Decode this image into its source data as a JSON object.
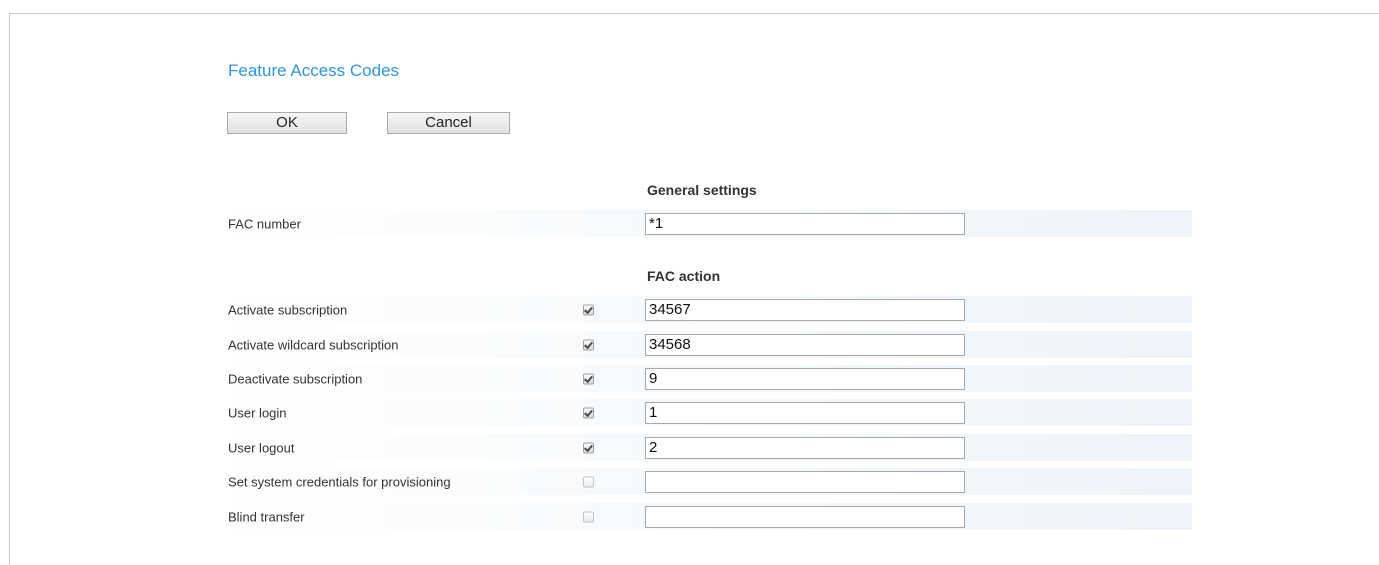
{
  "page": {
    "title": "Feature Access Codes"
  },
  "buttons": {
    "ok_label": "OK",
    "cancel_label": "Cancel"
  },
  "general_settings": {
    "heading": "General settings",
    "fac_number": {
      "label": "FAC number",
      "value": "*1"
    }
  },
  "fac_action": {
    "heading": "FAC action",
    "items": [
      {
        "label": "Activate subscription",
        "enabled": true,
        "value": "34567"
      },
      {
        "label": "Activate wildcard subscription",
        "enabled": true,
        "value": "34568"
      },
      {
        "label": "Deactivate subscription",
        "enabled": true,
        "value": "9"
      },
      {
        "label": "User login",
        "enabled": true,
        "value": "1"
      },
      {
        "label": "User logout",
        "enabled": true,
        "value": "2"
      },
      {
        "label": "Set system credentials for provisioning",
        "enabled": false,
        "value": ""
      },
      {
        "label": "Blind transfer",
        "enabled": false,
        "value": ""
      }
    ]
  },
  "colors": {
    "title": "#2f96e0",
    "row_tint": "#eef4f9"
  }
}
